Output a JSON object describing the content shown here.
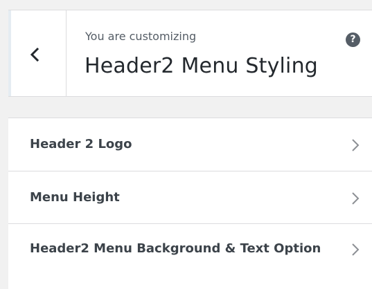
{
  "header": {
    "back_icon": "chevron-left-icon",
    "customizing_label": "You are customizing",
    "section_title": "Header2 Menu Styling",
    "help_icon": "question-mark-icon",
    "help_glyph": "?"
  },
  "menu": {
    "items": [
      {
        "label": "Header 2 Logo",
        "icon": "chevron-right-icon"
      },
      {
        "label": "Menu Height",
        "icon": "chevron-right-icon"
      },
      {
        "label": "Header2 Menu Background & Text Option",
        "icon": "chevron-right-icon"
      }
    ]
  },
  "colors": {
    "text_primary": "#23282d",
    "text_secondary": "#555d66",
    "background": "#f1f1f1",
    "border": "#dcdcde"
  }
}
